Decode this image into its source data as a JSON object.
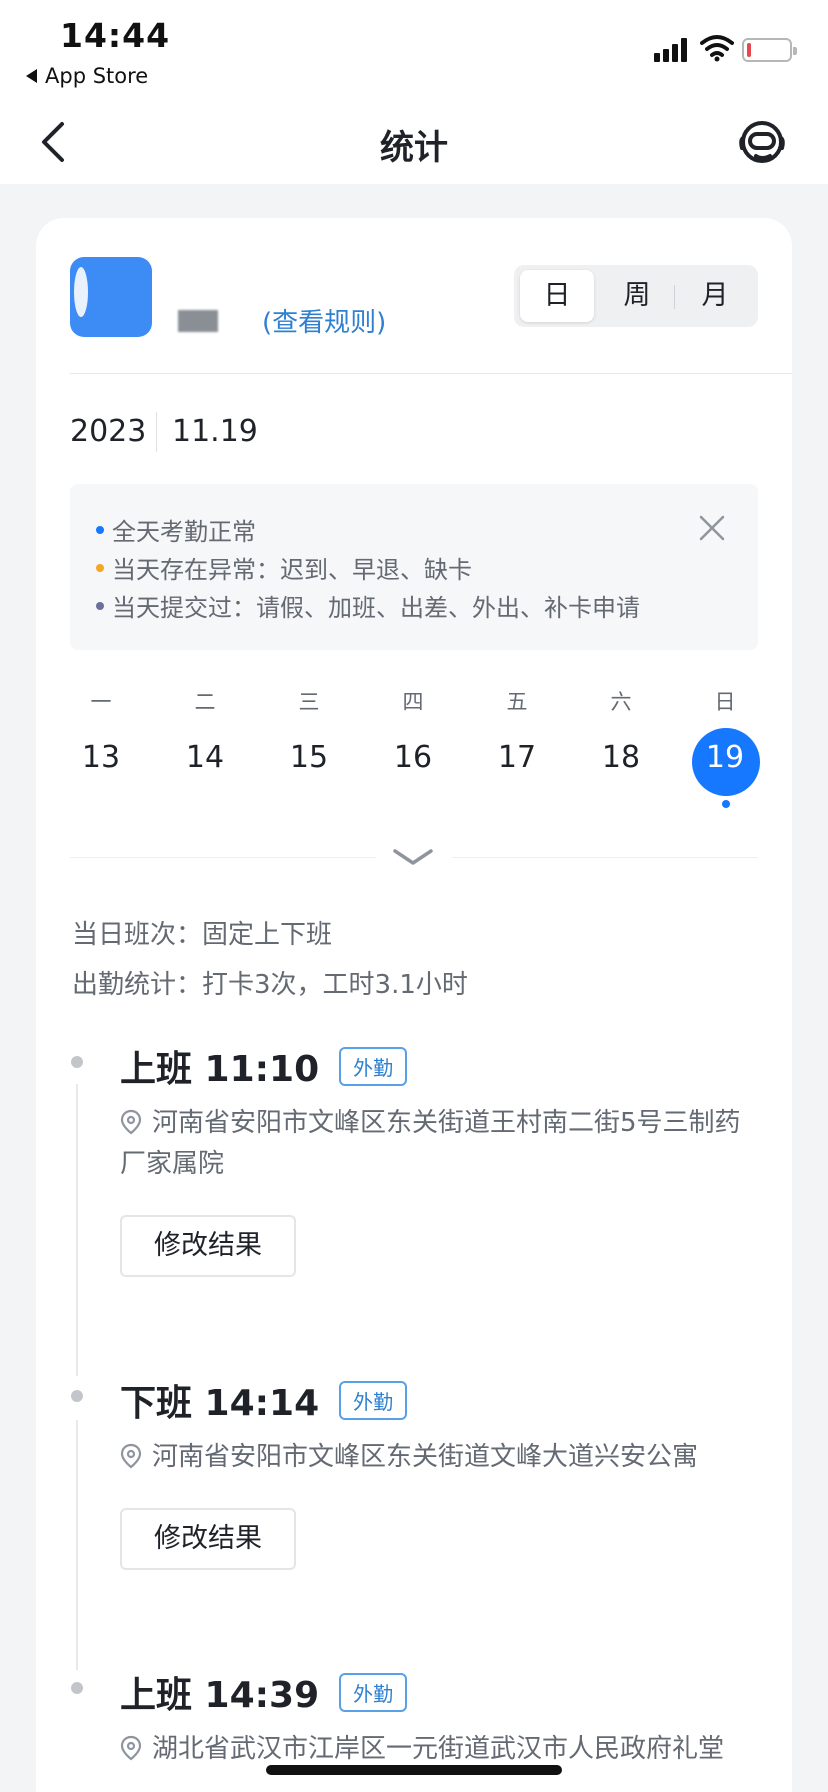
{
  "status_bar": {
    "time": "14:44",
    "back_app": "App Store"
  },
  "nav": {
    "title": "统计"
  },
  "profile": {
    "rule_link": "(查看规则)"
  },
  "segment": {
    "options": [
      "日",
      "周",
      "月"
    ],
    "selected": "日"
  },
  "date": {
    "year": "2023",
    "month_day": "11.19"
  },
  "legend": {
    "items": [
      {
        "text": "全天考勤正常",
        "color": "#1677ff"
      },
      {
        "text": "当天存在异常：迟到、早退、缺卡",
        "color": "#f5a623"
      },
      {
        "text": "当天提交过：请假、加班、出差、外出、补卡申请",
        "color": "#6b6f9b"
      }
    ]
  },
  "calendar": {
    "weekdays": [
      "一",
      "二",
      "三",
      "四",
      "五",
      "六",
      "日"
    ],
    "days": [
      "13",
      "14",
      "15",
      "16",
      "17",
      "18",
      "19"
    ],
    "selected_day": "19"
  },
  "summary": {
    "shift": "当日班次：固定上下班",
    "stats": "出勤统计：打卡3次，工时3.1小时"
  },
  "punches": [
    {
      "title": "上班 11:10",
      "tag": "外勤",
      "address": "河南省安阳市文峰区东关街道王村南二街5号三制药厂家属院",
      "button": "修改结果"
    },
    {
      "title": "下班 14:14",
      "tag": "外勤",
      "address": "河南省安阳市文峰区东关街道文峰大道兴安公寓",
      "button": "修改结果"
    },
    {
      "title": "上班 14:39",
      "tag": "外勤",
      "address": "湖北省武汉市江岸区一元街道武汉市人民政府礼堂"
    }
  ]
}
